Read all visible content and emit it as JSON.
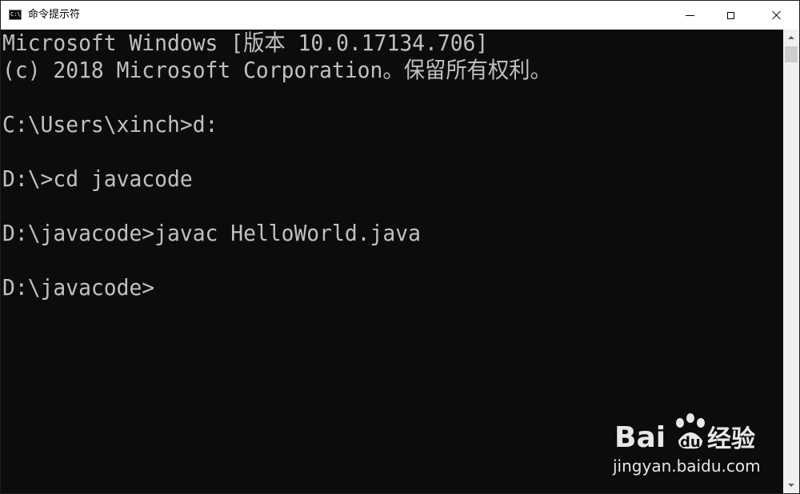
{
  "window": {
    "title": "命令提示符",
    "app_icon_text": "C:\\",
    "controls": {
      "minimize": "minimize",
      "maximize": "maximize",
      "close": "close"
    }
  },
  "console": {
    "lines": [
      "Microsoft Windows [版本 10.0.17134.706]",
      "(c) 2018 Microsoft Corporation。保留所有权利。",
      "",
      "C:\\Users\\xinch>d:",
      "",
      "D:\\>cd javacode",
      "",
      "D:\\javacode>javac HelloWorld.java",
      "",
      "D:\\javacode>"
    ],
    "text_color": "#c0c0c0",
    "background_color": "#0c0c0c"
  },
  "watermark": {
    "brand_text": "Bai",
    "brand_suffix": "du",
    "brand_cn": "经验",
    "url": "jingyan.baidu.com"
  }
}
